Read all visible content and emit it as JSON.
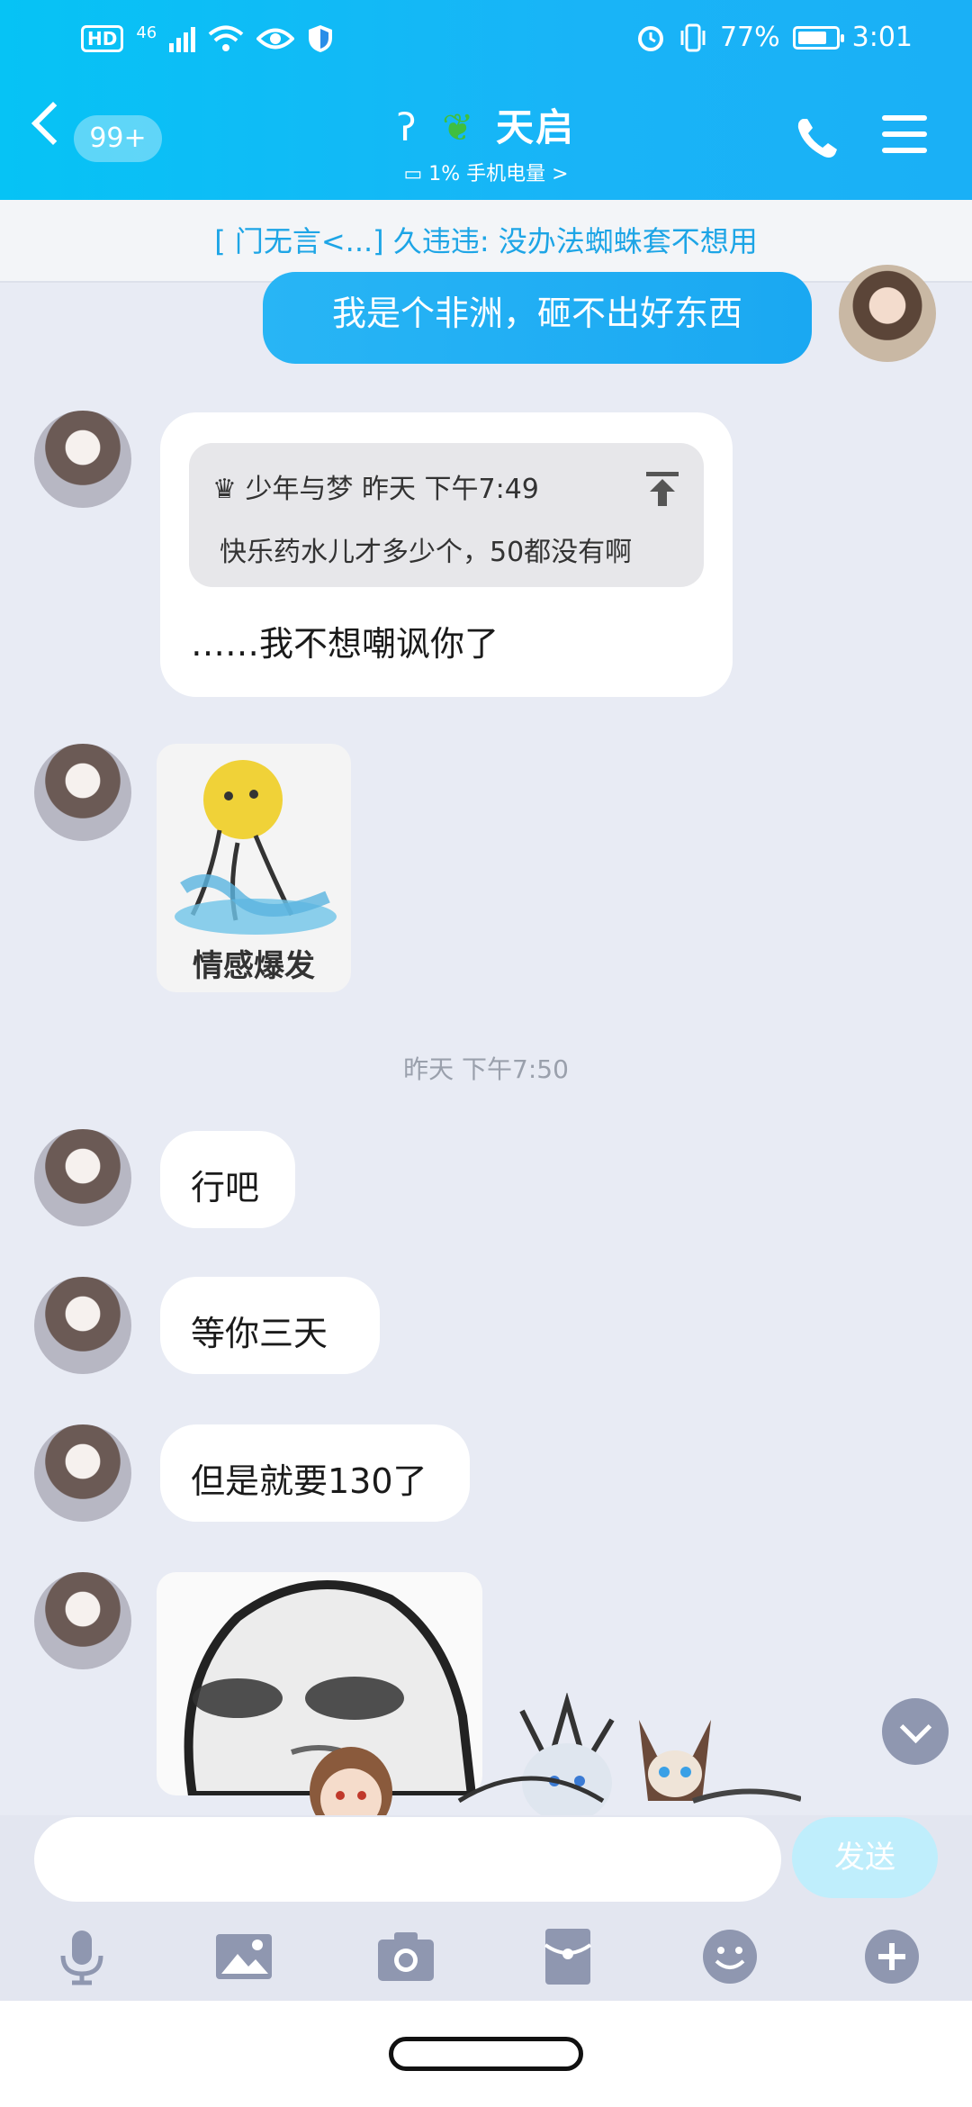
{
  "status_bar": {
    "hd": "HD",
    "network": "46",
    "battery_pct": "77%",
    "time": "3:01",
    "battery_level": 0.77
  },
  "header": {
    "unread_badge": "99+",
    "contact_name": "天启",
    "subtitle": "1% 手机电量 >",
    "icons": [
      "back-icon",
      "ear-icon",
      "sprout-icon",
      "phone-icon",
      "menu-icon"
    ]
  },
  "banner": {
    "text": "[ 门无言<...] 久违违: 没办法蜘蛛套不想用"
  },
  "messages": {
    "self_1": "我是个非洲，砸不出好东西",
    "quote_sender": "少年与梦 昨天 下午7:49",
    "quote_text": "快乐药水儿才多少个，50都没有啊",
    "reply_text": "……我不想嘲讽你了",
    "sticker_1_caption": "情感爆发",
    "time_separator": "昨天 下午7:50",
    "msg_ok": "行吧",
    "msg_wait": "等你三天",
    "msg_but": "但是就要130了"
  },
  "input": {
    "placeholder": "",
    "send_label": "发送"
  },
  "toolbar": {
    "items": [
      "microphone-icon",
      "image-icon",
      "camera-icon",
      "red-packet-icon",
      "emoji-icon",
      "plus-icon"
    ]
  },
  "colors": {
    "header_start": "#06c3f5",
    "header_end": "#1ab0f6",
    "chat_bg": "#e8ebf4",
    "self_bubble": "#1aa8f2",
    "send_button": "#bfeefc"
  }
}
